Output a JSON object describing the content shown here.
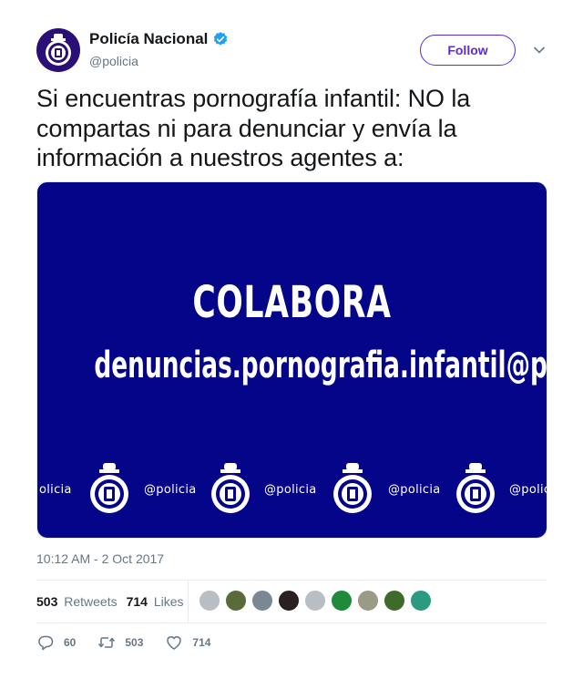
{
  "author": {
    "display_name": "Policía Nacional",
    "handle": "@policia",
    "verified": true,
    "brand_color": "#2a0f78"
  },
  "follow_label": "Follow",
  "tweet_text": "Si encuentras pornografía infantil: NO la compartas ni para denunciar y envía la información a nuestros agentes a:",
  "media": {
    "background": "#05058a",
    "title": "COLABORA",
    "email": "denuncias.pornografia.infantil@policia.es",
    "watermark": "@policia",
    "watermark_left": "olicia",
    "watermark_right": "@polic"
  },
  "timestamp": "10:12 AM - 2 Oct 2017",
  "stats": {
    "retweets_count": "503",
    "retweets_label": "Retweets",
    "likes_count": "714",
    "likes_label": "Likes"
  },
  "liker_avatars": [
    "#b8bec4",
    "#5a6b3a",
    "#7a8894",
    "#2b2020",
    "#b8bec4",
    "#1f8a3a",
    "#9a9a86",
    "#3d6b2a",
    "#2a9a80"
  ],
  "actions": {
    "reply_count": "60",
    "retweet_count": "503",
    "like_count": "714"
  },
  "icons": {
    "reply": "reply-icon",
    "retweet": "retweet-icon",
    "like": "heart-icon",
    "caret": "chevron-down-icon",
    "verified": "verified-badge-icon"
  }
}
